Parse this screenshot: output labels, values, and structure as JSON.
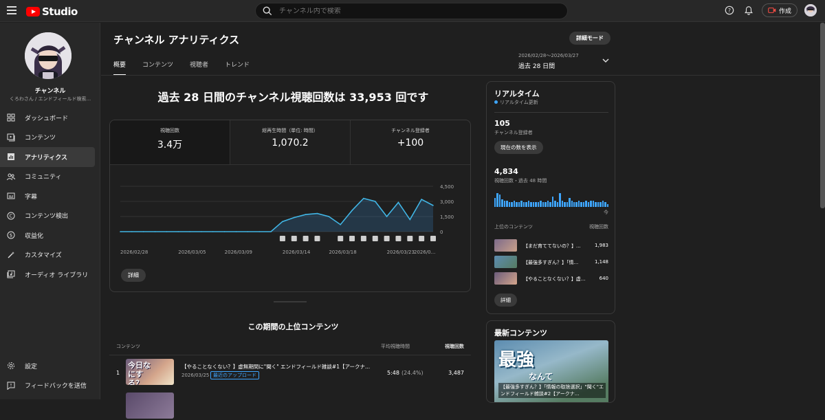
{
  "app": {
    "logo_text": "Studio"
  },
  "search": {
    "placeholder": "チャンネル内で検索"
  },
  "header": {
    "create_label": "作成"
  },
  "channel": {
    "name": "チャンネル",
    "subtitle": "くろわさん / エンドフィールド検索..."
  },
  "sidebar": {
    "items": [
      {
        "label": "ダッシュボード",
        "icon": "dashboard-icon"
      },
      {
        "label": "コンテンツ",
        "icon": "content-icon"
      },
      {
        "label": "アナリティクス",
        "icon": "analytics-icon",
        "active": true
      },
      {
        "label": "コミュニティ",
        "icon": "community-icon"
      },
      {
        "label": "字幕",
        "icon": "subtitles-icon"
      },
      {
        "label": "コンテンツ検出",
        "icon": "copyright-icon"
      },
      {
        "label": "収益化",
        "icon": "monetization-icon"
      },
      {
        "label": "カスタマイズ",
        "icon": "customize-icon"
      },
      {
        "label": "オーディオ ライブラリ",
        "icon": "audio-library-icon"
      }
    ],
    "bottom": [
      {
        "label": "設定",
        "icon": "settings-icon"
      },
      {
        "label": "フィードバックを送信",
        "icon": "feedback-icon"
      }
    ]
  },
  "page": {
    "title": "チャンネル アナリティクス",
    "advanced_mode": "詳細モード",
    "tabs": [
      "概要",
      "コンテンツ",
      "視聴者",
      "トレンド"
    ],
    "date_range": "2026/02/28〜2026/03/27",
    "period": "過去 28 日間",
    "headline": "過去 28 日間のチャンネル視聴回数は 33,953 回です"
  },
  "metrics": [
    {
      "label": "視聴回数",
      "value": "3.4万"
    },
    {
      "label": "総再生時間（単位: 時間）",
      "value": "1,070.2"
    },
    {
      "label": "チャンネル登録者",
      "value": "+100"
    }
  ],
  "chart_data": {
    "type": "area",
    "x": [
      "2026/02/28",
      "2026/03/01",
      "2026/03/02",
      "2026/03/03",
      "2026/03/04",
      "2026/03/05",
      "2026/03/06",
      "2026/03/07",
      "2026/03/08",
      "2026/03/09",
      "2026/03/10",
      "2026/03/11",
      "2026/03/12",
      "2026/03/13",
      "2026/03/14",
      "2026/03/15",
      "2026/03/16",
      "2026/03/17",
      "2026/03/18",
      "2026/03/19",
      "2026/03/20",
      "2026/03/21",
      "2026/03/22",
      "2026/03/23",
      "2026/03/24",
      "2026/03/25",
      "2026/03/26",
      "2026/03/27"
    ],
    "values": [
      0,
      0,
      0,
      0,
      0,
      0,
      0,
      0,
      0,
      0,
      0,
      0,
      0,
      0,
      1000,
      1400,
      1700,
      1800,
      1500,
      700,
      2100,
      3300,
      3000,
      1500,
      2900,
      1200,
      3200,
      2600
    ],
    "x_tick_labels": [
      "2026/02/28",
      "2026/03/05",
      "2026/03/09",
      "2026/03/14",
      "2026/03/18",
      "2026/03/23",
      "2026/0..."
    ],
    "y_ticks": [
      "4,500",
      "3,000",
      "1,500",
      "0"
    ],
    "ylim": [
      0,
      4500
    ],
    "grid": true
  },
  "chart_details": "詳細",
  "top_content": {
    "title": "この期間の上位コンテンツ",
    "col_content": "コンテンツ",
    "col_avg": "平均視聴時間",
    "col_views": "視聴回数",
    "rows": [
      {
        "num": "1",
        "title": "【やることなくない？】虚無期間に\"聞く\" エンドフィールド雑談#1【アークナ...",
        "date": "2026/03/25",
        "badge": "最近のアップロード",
        "avg": "5:48",
        "pct": "(24.4%)",
        "views": "3,487",
        "thumb_text": "今日なにする？"
      }
    ]
  },
  "realtime": {
    "title": "リアルタイム",
    "subtitle": "リアルタイム更新",
    "subs": "105",
    "subs_label": "チャンネル登録者",
    "show_button": "現在の数を表示",
    "views": "4,834",
    "views_label": "視聴回数・過去 48 時間",
    "now_label": "今",
    "bars": [
      0.6,
      0.9,
      0.8,
      0.5,
      0.4,
      0.4,
      0.3,
      0.3,
      0.4,
      0.3,
      0.3,
      0.4,
      0.3,
      0.3,
      0.4,
      0.3,
      0.3,
      0.3,
      0.3,
      0.4,
      0.3,
      0.3,
      0.4,
      0.3,
      0.7,
      0.4,
      0.3,
      0.9,
      0.4,
      0.3,
      0.3,
      0.6,
      0.4,
      0.3,
      0.3,
      0.4,
      0.3,
      0.3,
      0.4,
      0.3,
      0.4,
      0.4,
      0.3,
      0.3,
      0.3,
      0.4,
      0.3,
      0.2
    ],
    "top_head": "上位のコンテンツ",
    "top_head_views": "視聴回数",
    "top": [
      {
        "title": "【まだ育ててないの？】...",
        "views": "1,983"
      },
      {
        "title": "【最強多すぎん？】「情...",
        "views": "1,148"
      },
      {
        "title": "【やることなくない？】虚...",
        "views": "640"
      }
    ],
    "details": "詳細"
  },
  "latest": {
    "title": "最新コンテンツ",
    "thumb_big": "最強",
    "thumb_small": "なんて",
    "caption": "【最強多すぎん？】「情報の取捨選択」\"聞く\"エンドフィールド雑談#2【アークナ..."
  }
}
